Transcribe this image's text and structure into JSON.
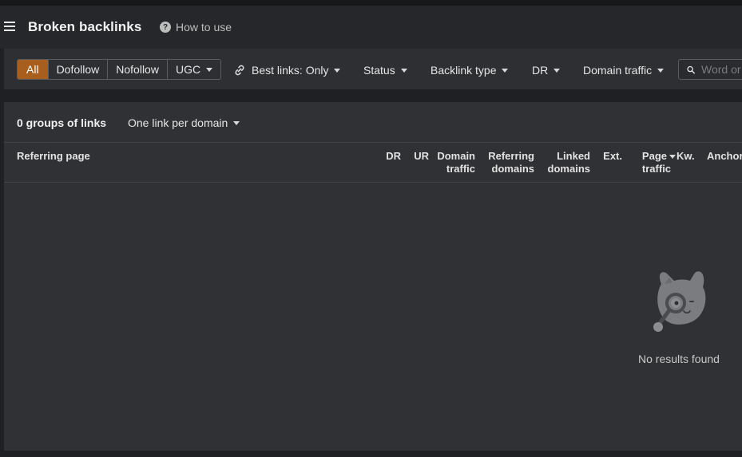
{
  "header": {
    "title": "Broken backlinks",
    "help_label": "How to use"
  },
  "filters": {
    "segments": [
      "All",
      "Dofollow",
      "Nofollow",
      "UGC"
    ],
    "active_segment": "All",
    "best_links": "Best links: Only",
    "status": "Status",
    "backlink_type": "Backlink type",
    "dr": "DR",
    "domain_traffic": "Domain traffic",
    "search_placeholder": "Word or"
  },
  "summary": {
    "groups": "0 groups of links",
    "grouping": "One link per domain"
  },
  "table": {
    "columns": {
      "referring_page": "Referring page",
      "dr": "DR",
      "ur": "UR",
      "domain_traffic_1": "Domain",
      "domain_traffic_2": "traffic",
      "referring_domains_1": "Referring",
      "referring_domains_2": "domains",
      "linked_domains_1": "Linked",
      "linked_domains_2": "domains",
      "ext": "Ext.",
      "page_traffic_1": "Page",
      "page_traffic_2": "traffic",
      "kw": "Kw.",
      "anchor": "Anchor"
    },
    "rows": []
  },
  "empty_state": {
    "message": "No results found",
    "icon": "mascot-magnifier-icon"
  },
  "colors": {
    "active_segment": "#a85f1e",
    "panel": "#303134",
    "header": "#26272a"
  }
}
